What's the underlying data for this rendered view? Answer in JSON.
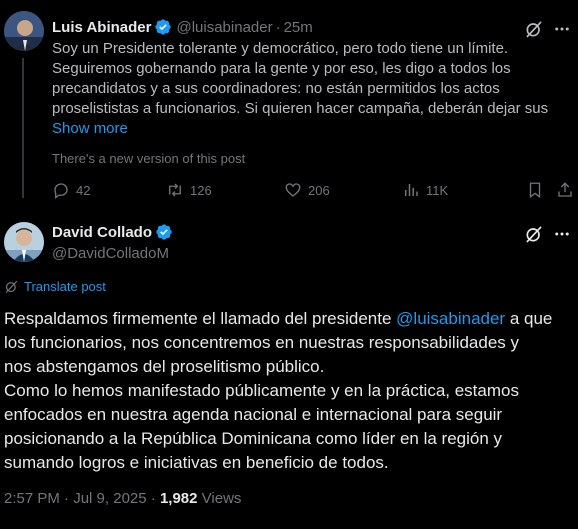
{
  "quoted_post": {
    "author_name": "Luis Abinader",
    "author_handle": "@luisabinader",
    "separator": "·",
    "time_ago": "25m",
    "body_lines": [
      "Soy un Presidente tolerante y democrático, pero todo tiene un límite.",
      "Seguiremos gobernando para la gente y por eso, les digo a todos los",
      "precandidatos y a sus coordinadores: no están permitidos los actos",
      "proselististas a funcionarios. Si quieren hacer campaña, deberán dejar sus"
    ],
    "show_more_label": "Show more",
    "new_version_notice": "There's a new version of this post",
    "actions": {
      "replies": "42",
      "reposts": "126",
      "likes": "206",
      "views": "11K"
    }
  },
  "main_post": {
    "author_name": "David Collado",
    "author_handle": "@DavidColladoM",
    "translate_label": "Translate post",
    "body": {
      "l1_pre": "Respaldamos firmemente el llamado del presidente ",
      "l1_mention": "@luisabinader",
      "l1_post": " a que",
      "l2": "los funcionarios, nos concentremos en nuestras responsabilidades y",
      "l3": "nos abstengamos del proselitismo público.",
      "l4": "Como lo hemos manifestado públicamente y en la práctica, estamos",
      "l5": "enfocados en nuestra agenda nacional e internacional para seguir",
      "l6": "posicionando a la República Dominicana como líder en la región y",
      "l7": "sumando logros e iniciativas en beneficio de todos."
    },
    "meta": {
      "time": "2:57 PM",
      "separator": "·",
      "date": "Jul 9, 2025",
      "views_count": "1,982",
      "views_label": "Views"
    }
  },
  "colors": {
    "background": "#000000",
    "primary_text": "#e7e9ea",
    "secondary_text": "#71767b",
    "link_blue": "#1d9bf0",
    "verified_blue": "#1d9bf0"
  }
}
